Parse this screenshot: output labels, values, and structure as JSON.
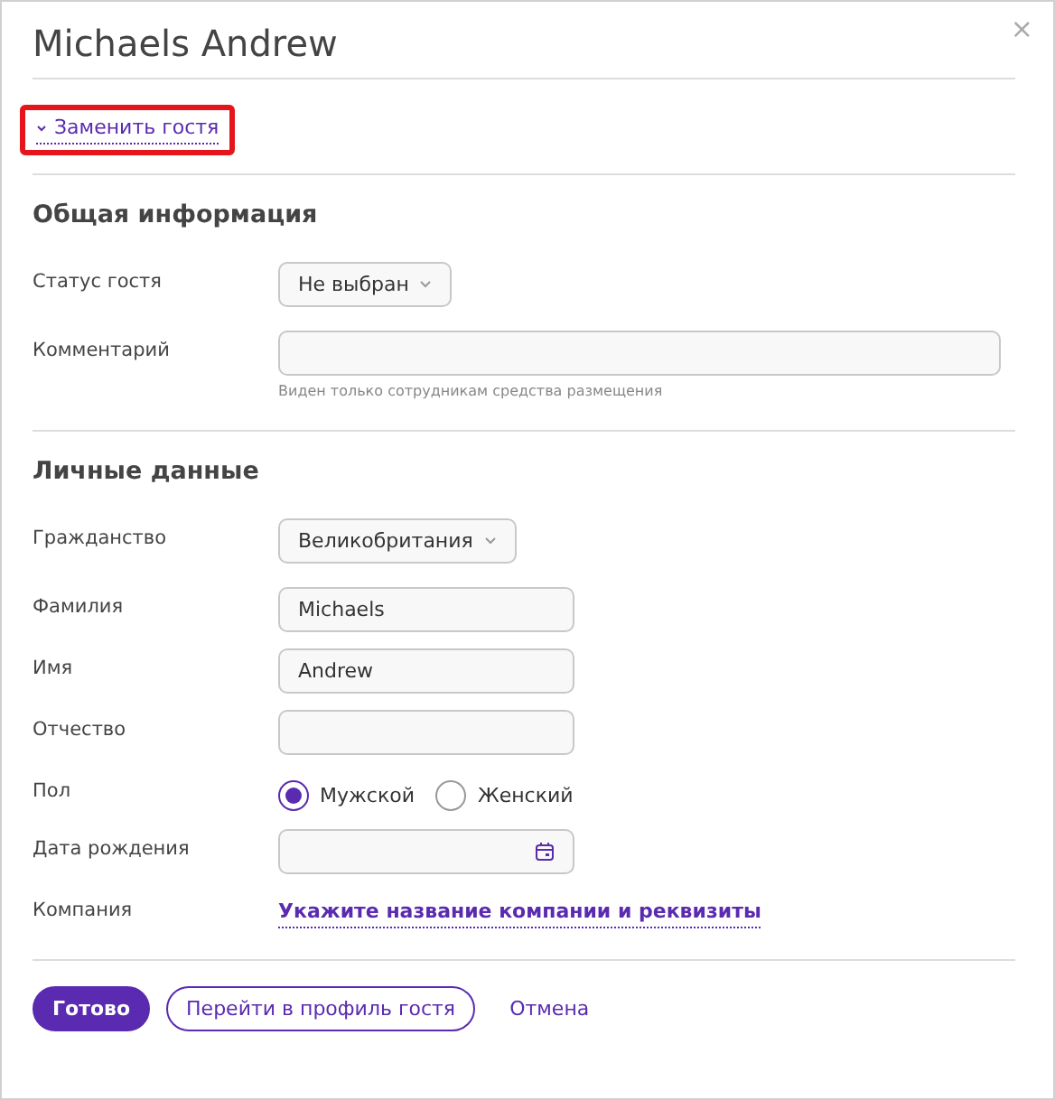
{
  "dialog": {
    "title": "Michaels Andrew",
    "close": "×"
  },
  "replace_link": {
    "label": "Заменить гостя",
    "highlighted": true
  },
  "sections": [
    {
      "title": "Общая информация",
      "fields": [
        {
          "kind": "select",
          "label": "Статус гостя",
          "value": "Не выбран"
        },
        {
          "kind": "input",
          "label": "Комментарий",
          "wide": true,
          "hint": "Виден только сотрудникам средства размещения"
        }
      ]
    },
    {
      "title": "Личные данные",
      "fields": [
        {
          "kind": "select",
          "label": "Гражданство",
          "value": "Великобритания"
        },
        {
          "kind": "input",
          "label": "Фамилия",
          "value": "Michaels"
        },
        {
          "kind": "input",
          "label": "Имя",
          "value": "Andrew"
        },
        {
          "kind": "input",
          "label": "Отчество"
        },
        {
          "kind": "radio",
          "label": "Пол",
          "options": [
            {
              "label": "Мужской",
              "selected": true
            },
            {
              "label": "Женский",
              "selected": false
            }
          ]
        },
        {
          "kind": "date",
          "label": "Дата рождения"
        },
        {
          "kind": "link",
          "label": "Компания",
          "value": "Укажите название компании и реквизиты"
        }
      ]
    }
  ],
  "buttons": [
    {
      "kind": "primary",
      "label": "Готово"
    },
    {
      "kind": "outline",
      "label": "Перейти в профиль гостя"
    },
    {
      "kind": "text",
      "label": "Отмена"
    }
  ]
}
